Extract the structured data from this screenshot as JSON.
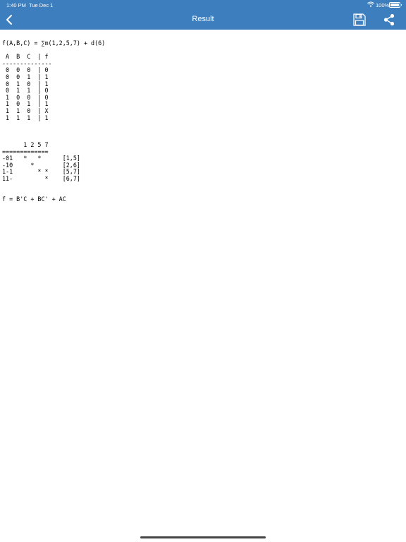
{
  "status_bar": {
    "time": "1:40 PM",
    "date": "Tue Dec 1",
    "battery_percent": "100%"
  },
  "nav": {
    "title": "Result",
    "back_icon": "chevron-left-icon",
    "save_icon": "floppy-disk-icon",
    "share_icon": "share-icon"
  },
  "colors": {
    "nav_background": "#3d7ebf",
    "text": "#000000"
  },
  "result_lines": [
    "f(A,B,C) = ∑m(1,2,5,7) + d(6)",
    "",
    " A  B  C  | f",
    "--------------",
    " 0  0  0  | 0",
    " 0  0  1  | 1",
    " 0  1  0  | 1",
    " 0  1  1  | 0",
    " 1  0  0  | 0",
    " 1  0  1  | 1",
    " 1  1  0  | X",
    " 1  1  1  | 1",
    "",
    "",
    "",
    "      1 2 5 7",
    "=============",
    "-01   *   *      [1,5]",
    "-10     *        [2,6]",
    "1-1       * *    [5,7]",
    "11-         *    [6,7]",
    "",
    "",
    "f = B'C + BC' + AC"
  ]
}
